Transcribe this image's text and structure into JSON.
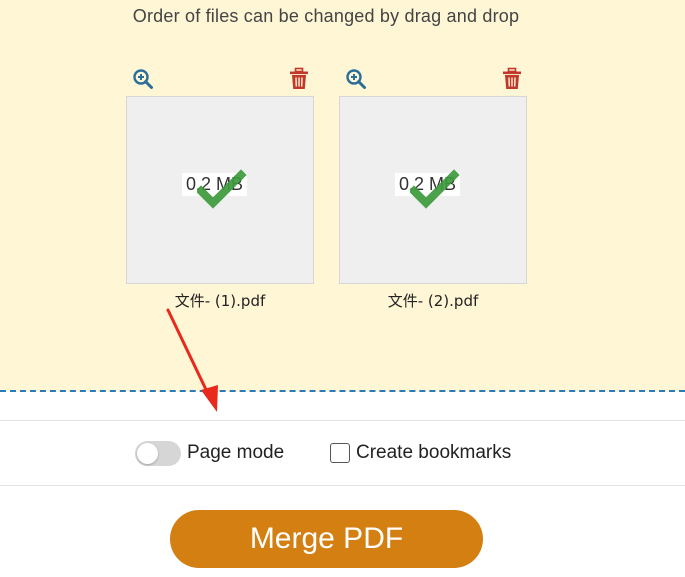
{
  "drop_area": {
    "hint": "Order of files can be changed by drag and drop"
  },
  "files": [
    {
      "name": "文件- (1).pdf",
      "size": "0.2 MB"
    },
    {
      "name": "文件- (2).pdf",
      "size": "0.2 MB"
    }
  ],
  "icons": {
    "zoom": "magnify-plus-icon",
    "delete": "trash-icon",
    "status": "checkmark-icon"
  },
  "options": {
    "page_mode_label": "Page mode",
    "page_mode_on": false,
    "bookmarks_label": "Create bookmarks",
    "bookmarks_checked": false
  },
  "merge": {
    "label": "Merge PDF"
  },
  "colors": {
    "drop_bg": "#fff6d6",
    "dashed_border": "#2b7bb9",
    "zoom_icon": "#2a6e99",
    "delete_icon": "#c0392b",
    "check": "#3c9a3c",
    "merge_button": "#d47f12",
    "annotation_arrow": "#e8291c"
  }
}
